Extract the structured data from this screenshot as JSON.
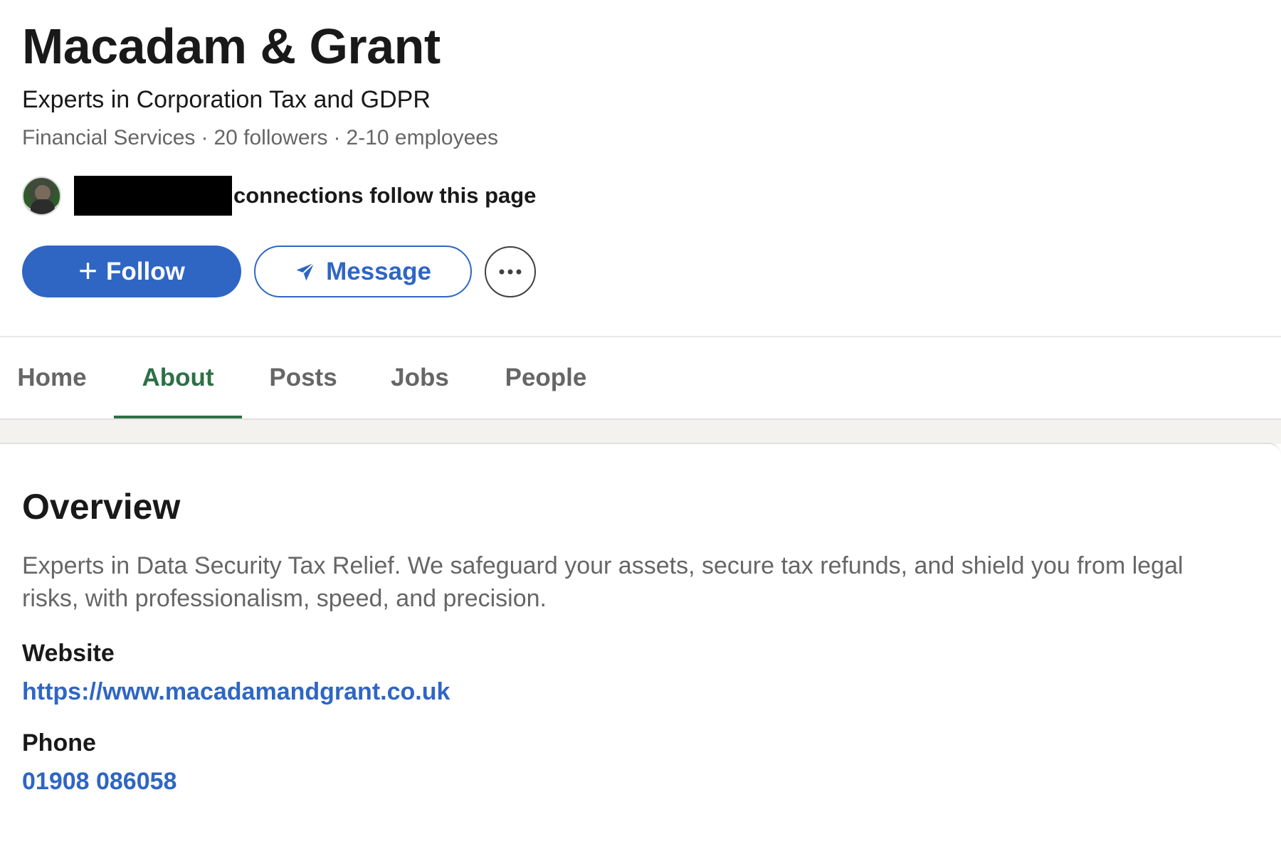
{
  "company": {
    "name": "Macadam & Grant",
    "tagline": "Experts in Corporation Tax and GDPR",
    "industry": "Financial Services",
    "followers": "20 followers",
    "employees": "2-10 employees",
    "separator": "·"
  },
  "connections": {
    "text": "connections follow this page",
    "avatar_icon": "person-avatar"
  },
  "actions": {
    "follow_label": "Follow",
    "follow_icon": "plus-icon",
    "message_label": "Message",
    "message_icon": "send-icon",
    "more_icon": "more-horizontal-icon"
  },
  "tabs": [
    {
      "label": "Home",
      "active": false
    },
    {
      "label": "About",
      "active": true
    },
    {
      "label": "Posts",
      "active": false
    },
    {
      "label": "Jobs",
      "active": false
    },
    {
      "label": "People",
      "active": false
    }
  ],
  "overview": {
    "title": "Overview",
    "description": "Experts in Data Security Tax Relief. We safeguard your assets, secure tax refunds, and shield you from legal risks, with professionalism, speed, and precision.",
    "website_label": "Website",
    "website_url": "https://www.macadamandgrant.co.uk",
    "phone_label": "Phone",
    "phone": "01908 086058"
  },
  "colors": {
    "brand_blue": "#2f66c4",
    "active_tab_green": "#2e7046",
    "muted_text": "#666666"
  }
}
